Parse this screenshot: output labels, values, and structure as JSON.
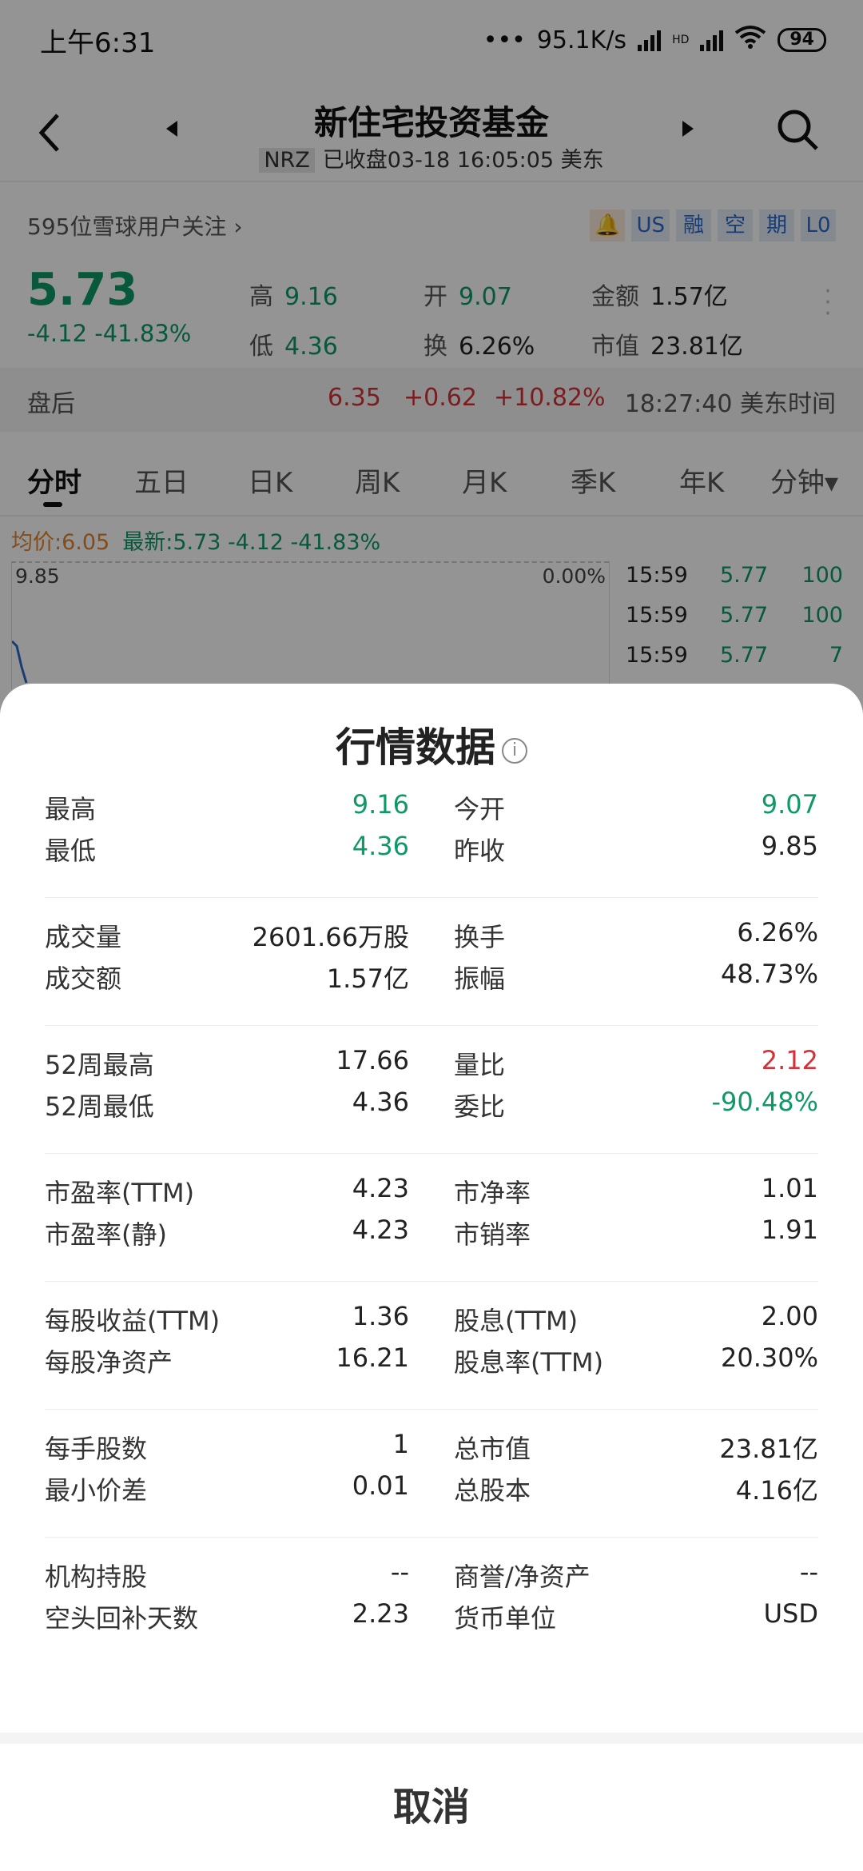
{
  "status_bar": {
    "time": "上午6:31",
    "speed": "95.1K/s",
    "network": "HD",
    "battery": "94"
  },
  "nav": {
    "title": "新住宅投资基金",
    "code": "NRZ",
    "subtitle": "已收盘03-18 16:05:05 美东"
  },
  "quote": {
    "followers": "595位雪球用户关注",
    "badges": [
      "US",
      "融",
      "空",
      "期",
      "L0"
    ],
    "price": "5.73",
    "change": "-4.12 -41.83%",
    "high_label": "高",
    "high": "9.16",
    "low_label": "低",
    "low": "4.36",
    "open_label": "开",
    "open": "9.07",
    "turnover_label": "换",
    "turnover": "6.26%",
    "amount_label": "金额",
    "amount": "1.57亿",
    "mktcap_label": "市值",
    "mktcap": "23.81亿"
  },
  "after_hours": {
    "label": "盘后",
    "price": "6.35",
    "change": "+0.62",
    "pct": "+10.82%",
    "time": "18:27:40 美东时间"
  },
  "tabs": [
    "分时",
    "五日",
    "日K",
    "周K",
    "月K",
    "季K",
    "年K",
    "分钟▾"
  ],
  "chart_header": {
    "avg": "均价:6.05",
    "latest": "最新:5.73 -4.12 -41.83%",
    "max": "9.85",
    "pct": "0.00%"
  },
  "trades": [
    {
      "time": "15:59",
      "price": "5.77",
      "qty": "100"
    },
    {
      "time": "15:59",
      "price": "5.77",
      "qty": "100"
    },
    {
      "time": "15:59",
      "price": "5.77",
      "qty": "7"
    }
  ],
  "sheet": {
    "title": "行情数据",
    "info_glyph": "i",
    "groups": [
      [
        {
          "l1": "最高",
          "v1": "9.16",
          "l2": "今开",
          "v2": "9.07"
        },
        {
          "l1": "最低",
          "v1": "4.36",
          "l2": "昨收",
          "v2": "9.85"
        }
      ],
      [
        {
          "l1": "成交量",
          "v1": "2601.66万股",
          "l2": "换手",
          "v2": "6.26%"
        },
        {
          "l1": "成交额",
          "v1": "1.57亿",
          "l2": "振幅",
          "v2": "48.73%"
        }
      ],
      [
        {
          "l1": "52周最高",
          "v1": "17.66",
          "l2": "量比",
          "v2": "2.12"
        },
        {
          "l1": "52周最低",
          "v1": "4.36",
          "l2": "委比",
          "v2": "-90.48%"
        }
      ],
      [
        {
          "l1": "市盈率(TTM)",
          "v1": "4.23",
          "l2": "市净率",
          "v2": "1.01"
        },
        {
          "l1": "市盈率(静)",
          "v1": "4.23",
          "l2": "市销率",
          "v2": "1.91"
        }
      ],
      [
        {
          "l1": "每股收益(TTM)",
          "v1": "1.36",
          "l2": "股息(TTM)",
          "v2": "2.00"
        },
        {
          "l1": "每股净资产",
          "v1": "16.21",
          "l2": "股息率(TTM)",
          "v2": "20.30%"
        }
      ],
      [
        {
          "l1": "每手股数",
          "v1": "1",
          "l2": "总市值",
          "v2": "23.81亿"
        },
        {
          "l1": "最小价差",
          "v1": "0.01",
          "l2": "总股本",
          "v2": "4.16亿"
        }
      ],
      [
        {
          "l1": "机构持股",
          "v1": "--",
          "l2": "商誉/净资产",
          "v2": "--"
        },
        {
          "l1": "空头回补天数",
          "v1": "2.23",
          "l2": "货币单位",
          "v2": "USD"
        }
      ]
    ],
    "cancel": "取消"
  },
  "colors": {
    "up": "#d2323a",
    "down": "#0f9968",
    "accent": "#2b68c9"
  }
}
